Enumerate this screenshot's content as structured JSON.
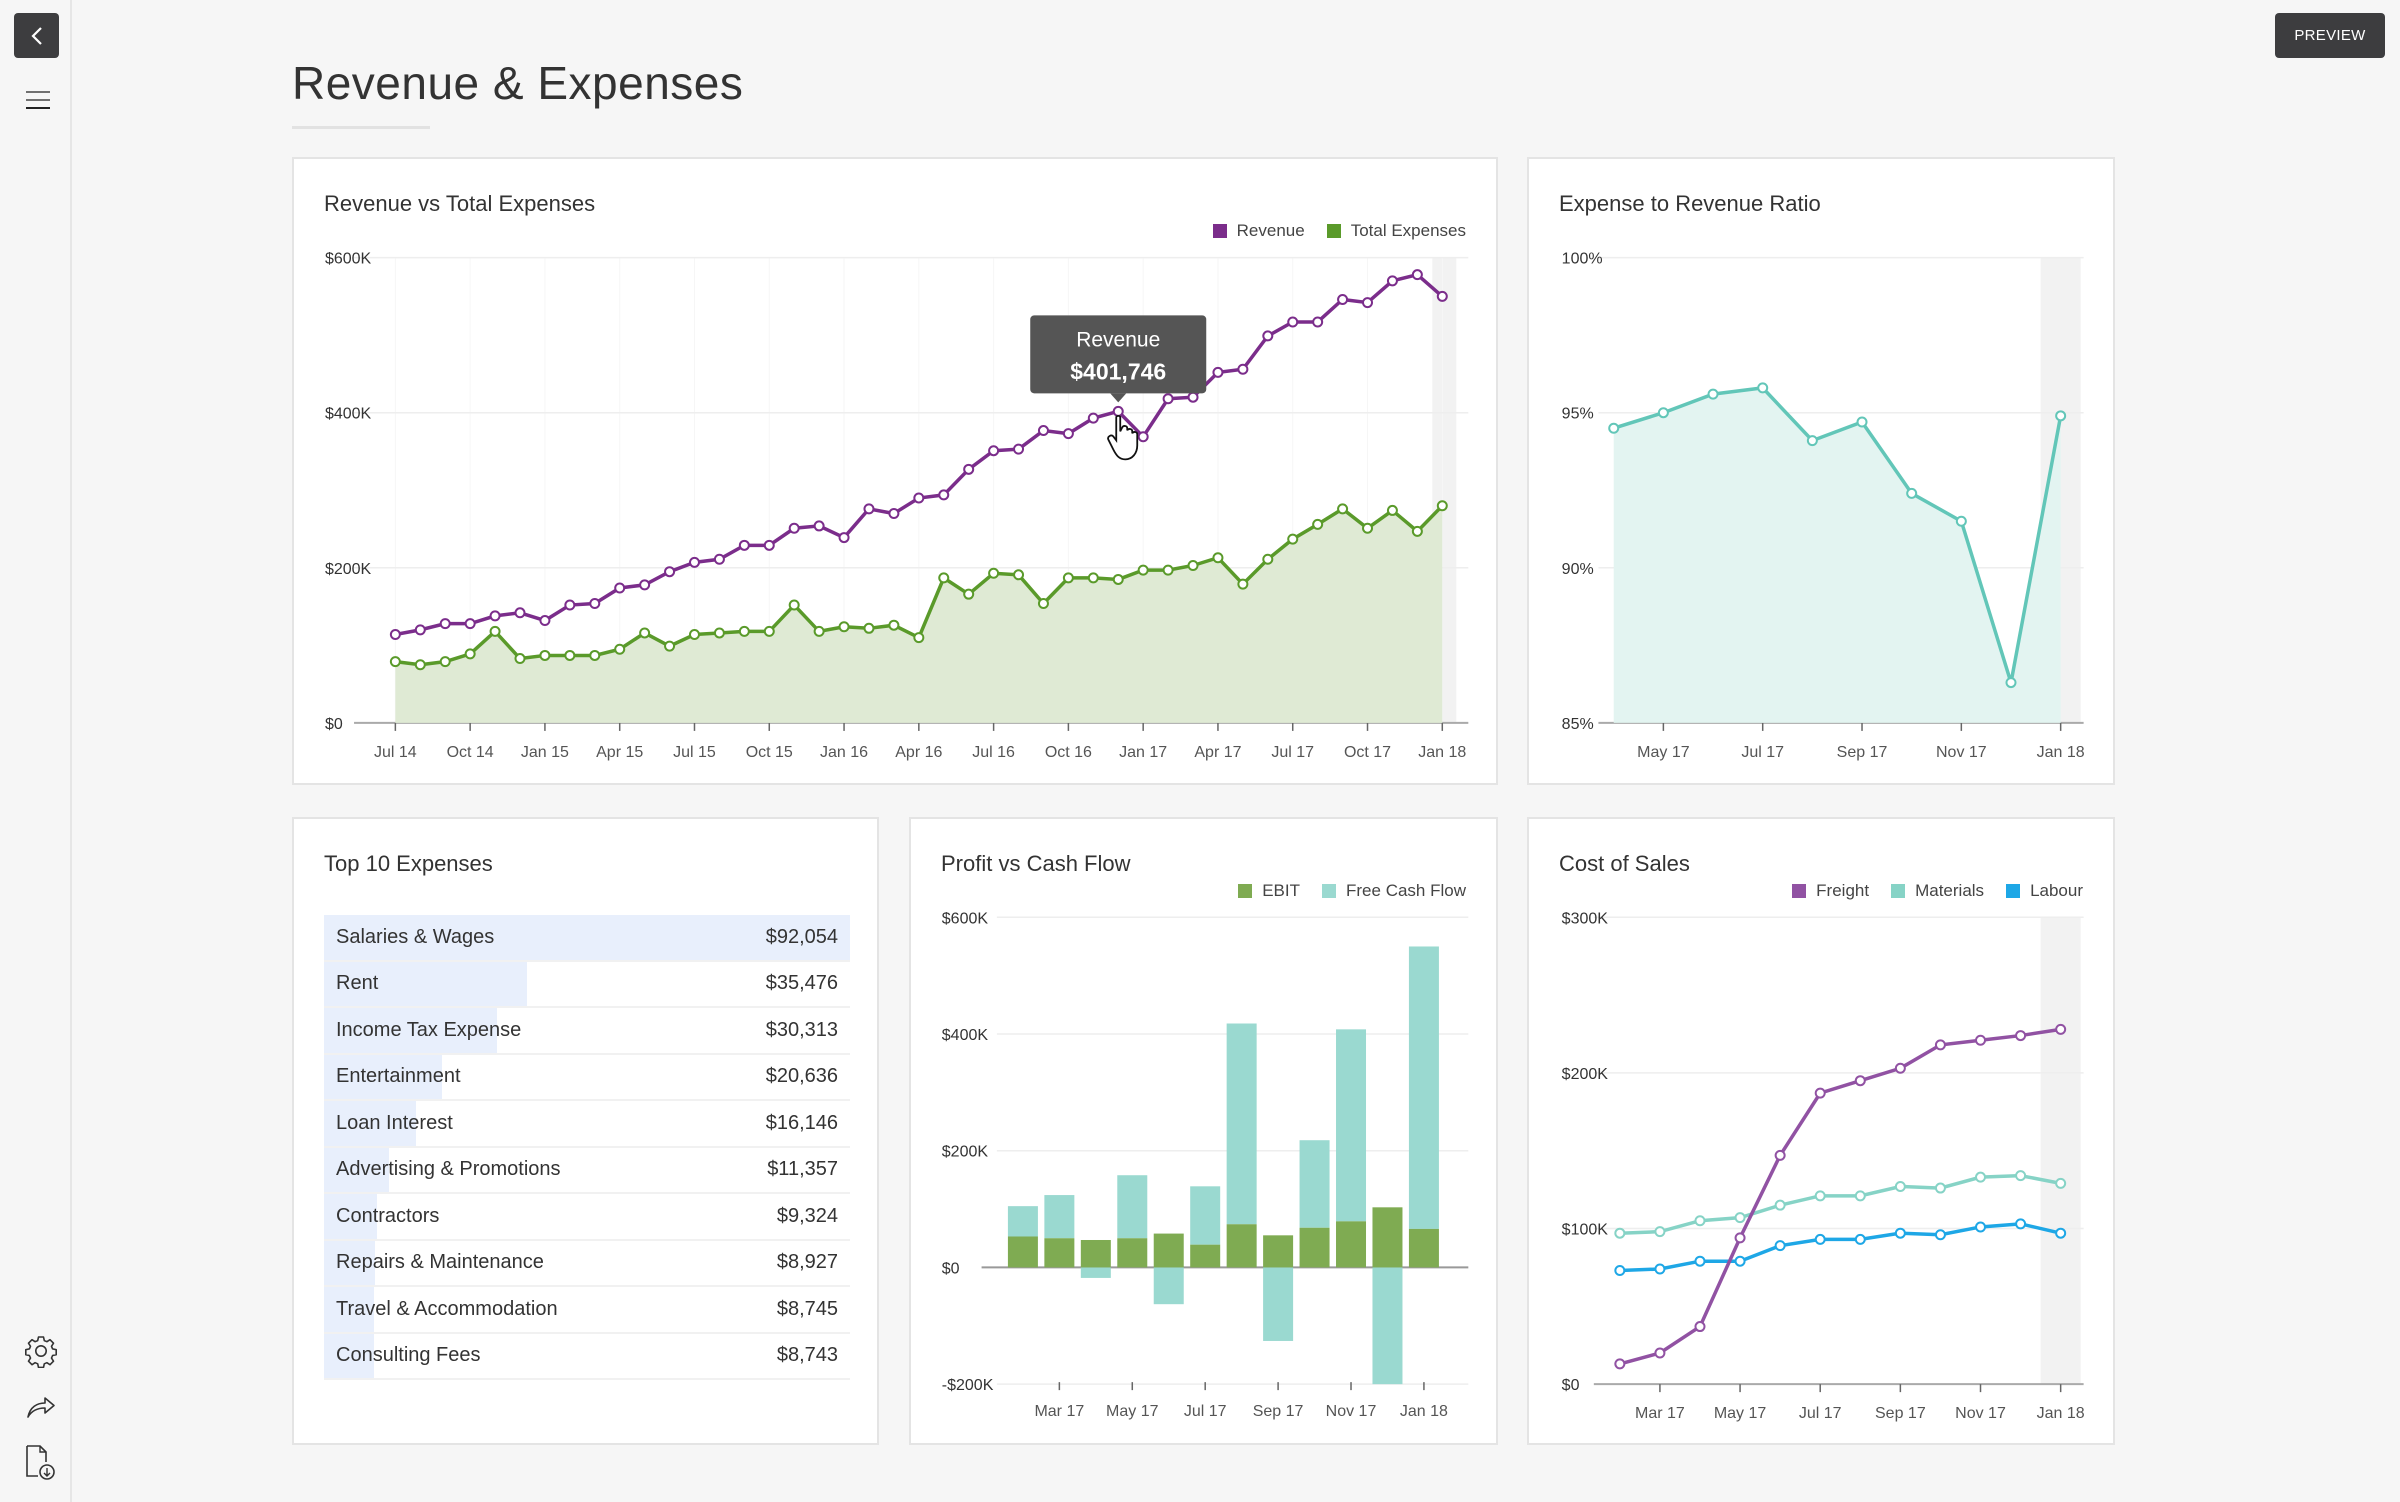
{
  "page": {
    "title": "Revenue & Expenses",
    "preview_label": "PREVIEW"
  },
  "sidebar": {
    "icons": [
      "back-icon",
      "hamburger-menu-icon",
      "gear-icon",
      "share-icon",
      "download-file-icon"
    ]
  },
  "colors": {
    "revenue": "#7b2d8b",
    "expenses": "#5a9a2a",
    "expenses_fill": "#dfead4",
    "ratio": "#62c6b8",
    "ratio_fill": "#e2f3f0",
    "ebit": "#7fab52",
    "fcf": "#9ad9d0",
    "freight": "#9152a3",
    "materials": "#86d3c6",
    "labour": "#1ea7e6",
    "bar_highlight": "#e8effc"
  },
  "charts": {
    "revenue_vs_expenses": {
      "title": "Revenue vs Total Expenses",
      "legend": [
        "Revenue",
        "Total Expenses"
      ],
      "tooltip": {
        "label": "Revenue",
        "value": "$401,746",
        "index": 29
      },
      "y_ticks": [
        "$0",
        "$200K",
        "$400K",
        "$600K"
      ],
      "x_ticks": [
        "Jul 14",
        "Oct 14",
        "Jan 15",
        "Apr 15",
        "Jul 15",
        "Oct 15",
        "Jan 16",
        "Apr 16",
        "Jul 16",
        "Oct 16",
        "Jan 17",
        "Apr 17",
        "Jul 17",
        "Oct 17",
        "Jan 18"
      ]
    },
    "expense_ratio": {
      "title": "Expense to Revenue Ratio",
      "y_ticks": [
        "85%",
        "90%",
        "95%",
        "100%"
      ],
      "x_ticks": [
        "May 17",
        "Jul 17",
        "Sep 17",
        "Nov 17",
        "Jan 18"
      ]
    },
    "top_expenses": {
      "title": "Top 10 Expenses"
    },
    "profit_cashflow": {
      "title": "Profit vs Cash Flow",
      "legend": [
        "EBIT",
        "Free Cash Flow"
      ],
      "y_ticks": [
        "-$200K",
        "$0",
        "$200K",
        "$400K",
        "$600K"
      ],
      "x_ticks": [
        "Mar 17",
        "May 17",
        "Jul 17",
        "Sep 17",
        "Nov 17",
        "Jan 18"
      ]
    },
    "cost_of_sales": {
      "title": "Cost of Sales",
      "legend": [
        "Freight",
        "Materials",
        "Labour"
      ],
      "y_ticks": [
        "$0",
        "$100K",
        "$200K",
        "$300K"
      ],
      "x_ticks": [
        "Mar 17",
        "May 17",
        "Jul 17",
        "Sep 17",
        "Nov 17",
        "Jan 18"
      ]
    }
  },
  "chart_data": [
    {
      "type": "line",
      "title": "Revenue vs Total Expenses",
      "xlabel": "",
      "ylabel": "",
      "ylim": [
        0,
        600000
      ],
      "grid": true,
      "legend": "top-right",
      "x": [
        "Jul 14",
        "Aug 14",
        "Sep 14",
        "Oct 14",
        "Nov 14",
        "Dec 14",
        "Jan 15",
        "Feb 15",
        "Mar 15",
        "Apr 15",
        "May 15",
        "Jun 15",
        "Jul 15",
        "Aug 15",
        "Sep 15",
        "Oct 15",
        "Nov 15",
        "Dec 15",
        "Jan 16",
        "Feb 16",
        "Mar 16",
        "Apr 16",
        "May 16",
        "Jun 16",
        "Jul 16",
        "Aug 16",
        "Sep 16",
        "Oct 16",
        "Nov 16",
        "Dec 16",
        "Jan 17",
        "Feb 17",
        "Mar 17",
        "Apr 17",
        "May 17",
        "Jun 17",
        "Jul 17",
        "Aug 17",
        "Sep 17",
        "Oct 17",
        "Nov 17",
        "Dec 17",
        "Jan 18"
      ],
      "series": [
        {
          "name": "Revenue",
          "values": [
            114000,
            120000,
            128000,
            128000,
            138000,
            142000,
            132000,
            152000,
            154000,
            174000,
            178000,
            195000,
            207000,
            211000,
            229000,
            229000,
            251000,
            254000,
            239000,
            276000,
            270000,
            290000,
            294000,
            327000,
            351000,
            353000,
            377000,
            373000,
            393000,
            401746,
            369000,
            418000,
            420000,
            452000,
            456000,
            499000,
            517000,
            517000,
            546000,
            542000,
            570000,
            578000,
            550000
          ]
        },
        {
          "name": "Total Expenses",
          "values": [
            79000,
            75000,
            79000,
            89000,
            118000,
            83000,
            87000,
            87000,
            87000,
            95000,
            116000,
            99000,
            114000,
            116000,
            118000,
            118000,
            152000,
            118000,
            124000,
            122000,
            126000,
            110000,
            187000,
            166000,
            193000,
            191000,
            154000,
            187000,
            187000,
            185000,
            197000,
            197000,
            203000,
            213000,
            179000,
            211000,
            237000,
            256000,
            276000,
            251000,
            274000,
            247000,
            280000
          ]
        }
      ]
    },
    {
      "type": "area",
      "title": "Expense to Revenue Ratio",
      "xlabel": "",
      "ylabel": "",
      "ylim": [
        85,
        100
      ],
      "grid": true,
      "x": [
        "Apr 17",
        "May 17",
        "Jun 17",
        "Jul 17",
        "Aug 17",
        "Sep 17",
        "Oct 17",
        "Nov 17",
        "Dec 17",
        "Jan 18"
      ],
      "series": [
        {
          "name": "Expense to Revenue Ratio",
          "values": [
            94.5,
            95.0,
            95.6,
            95.8,
            94.1,
            94.7,
            92.4,
            91.5,
            86.3,
            94.9
          ]
        }
      ]
    },
    {
      "type": "table",
      "title": "Top 10 Expenses",
      "rows": [
        {
          "label": "Salaries & Wages",
          "value": "$92,054",
          "amount": 92054
        },
        {
          "label": "Rent",
          "value": "$35,476",
          "amount": 35476
        },
        {
          "label": "Income Tax Expense",
          "value": "$30,313",
          "amount": 30313
        },
        {
          "label": "Entertainment",
          "value": "$20,636",
          "amount": 20636
        },
        {
          "label": "Loan Interest",
          "value": "$16,146",
          "amount": 16146
        },
        {
          "label": "Advertising & Promotions",
          "value": "$11,357",
          "amount": 11357
        },
        {
          "label": "Contractors",
          "value": "$9,324",
          "amount": 9324
        },
        {
          "label": "Repairs & Maintenance",
          "value": "$8,927",
          "amount": 8927
        },
        {
          "label": "Travel & Accommodation",
          "value": "$8,745",
          "amount": 8745
        },
        {
          "label": "Consulting Fees",
          "value": "$8,743",
          "amount": 8743
        }
      ]
    },
    {
      "type": "bar",
      "title": "Profit vs Cash Flow",
      "xlabel": "",
      "ylabel": "",
      "ylim": [
        -200000,
        600000
      ],
      "grid": true,
      "legend": "top-right",
      "categories": [
        "Feb 17",
        "Mar 17",
        "Apr 17",
        "May 17",
        "Jun 17",
        "Jul 17",
        "Aug 17",
        "Sep 17",
        "Oct 17",
        "Nov 17",
        "Dec 17",
        "Jan 18"
      ],
      "series": [
        {
          "name": "EBIT",
          "values": [
            53000,
            50000,
            47000,
            50000,
            58000,
            39000,
            74000,
            55000,
            68000,
            79000,
            103000,
            66000
          ]
        },
        {
          "name": "Free Cash Flow",
          "values": [
            52000,
            74000,
            -18000,
            108000,
            -63000,
            100000,
            344000,
            -126000,
            150000,
            329000,
            -210000,
            484000
          ]
        }
      ]
    },
    {
      "type": "line",
      "title": "Cost of Sales",
      "xlabel": "",
      "ylabel": "",
      "ylim": [
        0,
        300000
      ],
      "grid": true,
      "legend": "top-right",
      "x": [
        "Feb 17",
        "Mar 17",
        "Apr 17",
        "May 17",
        "Jun 17",
        "Jul 17",
        "Aug 17",
        "Sep 17",
        "Oct 17",
        "Nov 17",
        "Dec 17",
        "Jan 18"
      ],
      "series": [
        {
          "name": "Freight",
          "values": [
            13000,
            20000,
            37000,
            94000,
            147000,
            187000,
            195000,
            203000,
            218000,
            221000,
            224000,
            228000
          ]
        },
        {
          "name": "Materials",
          "values": [
            97000,
            98000,
            105000,
            107000,
            115000,
            121000,
            121000,
            127000,
            126000,
            133000,
            134000,
            129000
          ]
        },
        {
          "name": "Labour",
          "values": [
            73000,
            74000,
            79000,
            79000,
            89000,
            93000,
            93000,
            97000,
            96000,
            101000,
            103000,
            97000
          ]
        }
      ]
    }
  ]
}
